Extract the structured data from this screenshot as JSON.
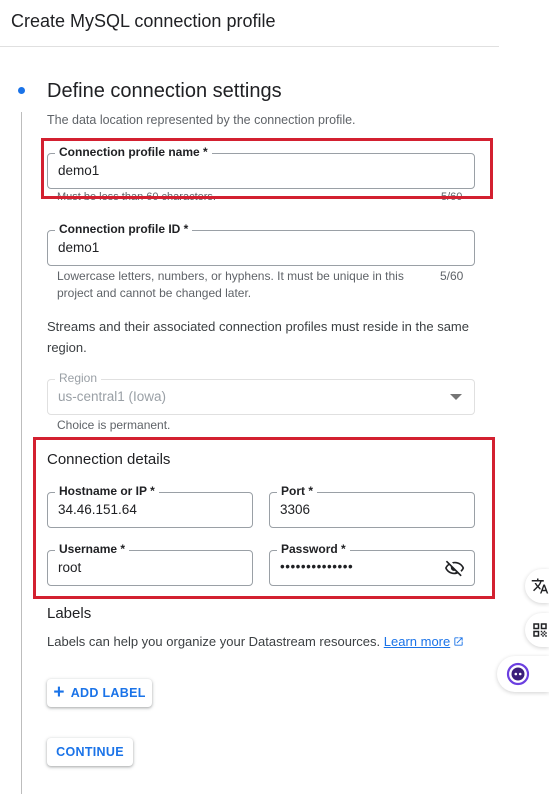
{
  "header": {
    "title": "Create MySQL connection profile"
  },
  "section": {
    "title": "Define connection settings",
    "description": "The data location represented by the connection profile."
  },
  "profile_name": {
    "label": "Connection profile name *",
    "value": "demo1",
    "hint": "Must be less than 60 characters.",
    "counter": "5/60"
  },
  "profile_id": {
    "label": "Connection profile ID *",
    "value": "demo1",
    "hint_line1": "Lowercase letters, numbers, or hyphens. It must be unique in this",
    "hint_line2": "project and cannot be changed later.",
    "counter": "5/60"
  },
  "region_note": {
    "line1": "Streams and their associated connection profiles must reside in the same",
    "line2": "region."
  },
  "region": {
    "label": "Region",
    "value": "us-central1 (Iowa)",
    "hint": "Choice is permanent."
  },
  "connection_details": {
    "title": "Connection details",
    "hostname": {
      "label": "Hostname or IP *",
      "value": "34.46.151.64"
    },
    "port": {
      "label": "Port *",
      "value": "3306"
    },
    "username": {
      "label": "Username *",
      "value": "root"
    },
    "password": {
      "label": "Password *",
      "value": "••••••••••••••"
    }
  },
  "labels": {
    "title": "Labels",
    "description": "Labels can help you organize your Datastream resources.",
    "learn_more": "Learn more",
    "add_label": "ADD LABEL"
  },
  "continue_label": "CONTINUE",
  "colors": {
    "accent": "#1a73e8",
    "highlight": "#d32030"
  },
  "icons": [
    "eye-off-icon",
    "dropdown-arrow-icon",
    "external-link-icon",
    "plus-icon",
    "translate-icon",
    "qr-code-icon",
    "assistant-icon"
  ]
}
